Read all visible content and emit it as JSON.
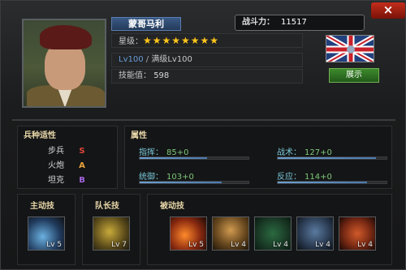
{
  "general": {
    "name": "蒙哥马利",
    "stars_label": "星级：",
    "stars": "★★★★★★★★",
    "level": "Lv100",
    "level_sep": "/",
    "max_level": "满级Lv100",
    "skill_points_label": "技能值：",
    "skill_points": "598"
  },
  "power": {
    "label": "战斗力：",
    "value": "11517"
  },
  "show_button": "展示",
  "close_icon": "×",
  "troops": {
    "title": "兵种适性",
    "items": [
      {
        "name": "步兵",
        "grade": "S"
      },
      {
        "name": "火炮",
        "grade": "A"
      },
      {
        "name": "坦克",
        "grade": "B"
      }
    ]
  },
  "attributes": {
    "title": "属性",
    "items": [
      {
        "label": "指挥：",
        "value": "85+0",
        "fill": 0.62
      },
      {
        "label": "战术：",
        "value": "127+0",
        "fill": 0.9
      },
      {
        "label": "统御：",
        "value": "103+0",
        "fill": 0.75
      },
      {
        "label": "反应：",
        "value": "114+0",
        "fill": 0.82
      }
    ]
  },
  "skills": {
    "active": {
      "title": "主动技",
      "lv": "Lv 5",
      "icon": "missile-icon"
    },
    "leader": {
      "title": "队长技",
      "lv": "Lv 7",
      "icon": "star-icon"
    },
    "passive": {
      "title": "被动技",
      "items": [
        {
          "lv": "Lv 5",
          "icon": "fire-icon"
        },
        {
          "lv": "Lv 4",
          "icon": "tank-icon"
        },
        {
          "lv": "Lv 4",
          "icon": "rank-icon"
        },
        {
          "lv": "Lv 4",
          "icon": "soldier-icon"
        },
        {
          "lv": "Lv 4",
          "icon": "blast-icon"
        }
      ]
    }
  },
  "colors": {
    "accent_gold": "#ffc51a",
    "grade_S": "#e0463a",
    "grade_A": "#e8a23a",
    "grade_B": "#a465e0",
    "close_red": "#c22d1c",
    "show_green": "#3c8a2c"
  }
}
